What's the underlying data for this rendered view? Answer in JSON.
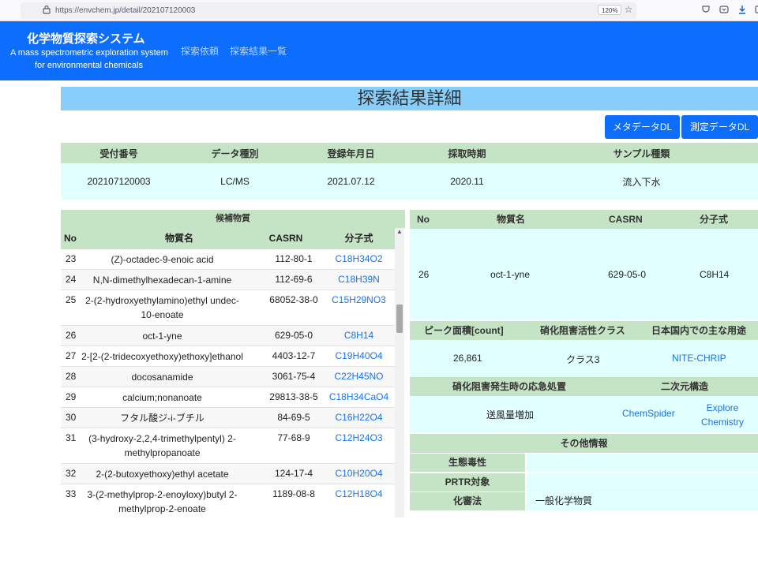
{
  "browser": {
    "url": "https://envchem.jp/detail/202107120003",
    "zoom": "120%"
  },
  "header": {
    "title": "化学物質探索システム",
    "subtitle_line1": "A mass spectrometric exploration system",
    "subtitle_line2": "for environmental chemicals",
    "nav": [
      "探索依頼",
      "探索結果一覧"
    ]
  },
  "page": {
    "title": "探索結果詳細",
    "buttons": {
      "metadata_dl": "メタデータDL",
      "measure_dl": "測定データDL"
    }
  },
  "meta": {
    "headers": [
      "受付番号",
      "データ種別",
      "登録年月日",
      "採取時期",
      "サンプル種類"
    ],
    "values": [
      "202107120003",
      "LC/MS",
      "2021.07.12",
      "2020.11",
      "流入下水"
    ]
  },
  "candidates": {
    "title": "候補物質",
    "headers": {
      "no": "No",
      "name": "物質名",
      "cas": "CASRN",
      "formula": "分子式"
    },
    "rows": [
      {
        "no": "23",
        "name": "(Z)-octadec-9-enoic acid",
        "cas": "112-80-1",
        "formula": "C18H34O2"
      },
      {
        "no": "24",
        "name": "N,N-dimethylhexadecan-1-amine",
        "cas": "112-69-6",
        "formula": "C18H39N"
      },
      {
        "no": "25",
        "name": "2-(2-hydroxyethylamino)ethyl undec-10-enoate",
        "cas": "68052-38-0",
        "formula": "C15H29NO3"
      },
      {
        "no": "26",
        "name": "oct-1-yne",
        "cas": "629-05-0",
        "formula": "C8H14"
      },
      {
        "no": "27",
        "name": "2-[2-(2-tridecoxyethoxy)ethoxy]ethanol",
        "cas": "4403-12-7",
        "formula": "C19H40O4"
      },
      {
        "no": "28",
        "name": "docosanamide",
        "cas": "3061-75-4",
        "formula": "C22H45NO"
      },
      {
        "no": "29",
        "name": "calcium;nonanoate",
        "cas": "29813-38-5",
        "formula": "C18H34CaO4"
      },
      {
        "no": "30",
        "name": "フタル酸ジ-i-ブチル",
        "cas": "84-69-5",
        "formula": "C16H22O4"
      },
      {
        "no": "31",
        "name": "(3-hydroxy-2,2,4-trimethylpentyl) 2-methylpropanoate",
        "cas": "77-68-9",
        "formula": "C12H24O3"
      },
      {
        "no": "32",
        "name": "2-(2-butoxyethoxy)ethyl acetate",
        "cas": "124-17-4",
        "formula": "C10H20O4"
      },
      {
        "no": "33",
        "name": "3-(2-methylprop-2-enoyloxy)butyl 2-methylprop-2-enoate",
        "cas": "1189-08-8",
        "formula": "C12H18O4"
      }
    ]
  },
  "detail": {
    "headers": {
      "no": "No",
      "name": "物質名",
      "cas": "CASRN",
      "formula": "分子式"
    },
    "no": "26",
    "name": "oct-1-yne",
    "cas": "629-05-0",
    "formula": "C8H14",
    "peak_header": "ピーク面積[count]",
    "nitrif_header": "硝化阻害活性クラス",
    "usage_header": "日本国内での主な用途",
    "peak": "26,861",
    "nitrif_class": "クラス3",
    "usage_link": "NITE-CHRIP",
    "emergency_header": "硝化阻害発生時の応急処置",
    "structure_header": "二次元構造",
    "emergency": "送風量増加",
    "chemspider": "ChemSpider",
    "explore_line1": "Explore",
    "explore_line2": "Chemistry",
    "other_header": "その他情報",
    "other": [
      {
        "label": "生態毒性",
        "value": ""
      },
      {
        "label": "PRTR対象",
        "value": ""
      },
      {
        "label": "化審法",
        "value": "一般化学物質"
      }
    ]
  }
}
